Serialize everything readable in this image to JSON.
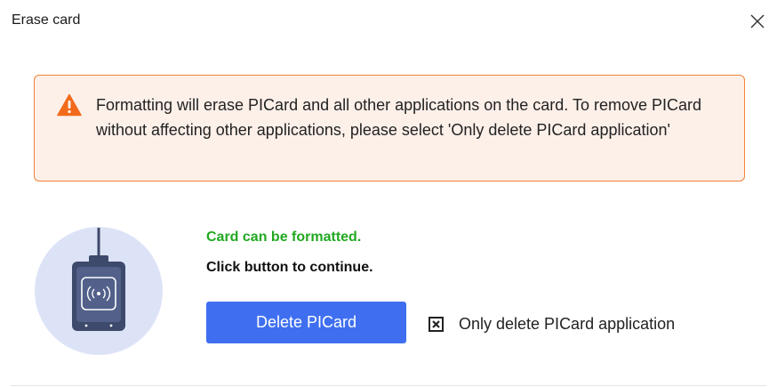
{
  "dialog": {
    "title": "Erase card",
    "close_icon": "close-icon"
  },
  "warning": {
    "icon": "warning-triangle-icon",
    "text": "Formatting will erase PICard and all other applications on the card. To remove PICard without affecting other applications, please select 'Only delete PICard application'"
  },
  "illustration": {
    "icon": "card-reader-icon"
  },
  "status": {
    "message": "Card can be formatted.",
    "instruction": "Click button to continue."
  },
  "actions": {
    "delete_label": "Delete PICard",
    "only_delete_label": "Only delete PICard application",
    "only_delete_checked": true
  },
  "colors": {
    "accent": "#3f6ff0",
    "success": "#22a822",
    "warning_border": "#f0843a",
    "warning_bg": "#fdf0e9",
    "warning_icon": "#f26a1b"
  }
}
